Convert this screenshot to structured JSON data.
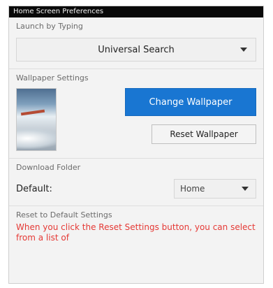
{
  "window": {
    "title": "Home Screen Preferences"
  },
  "launchpad": {
    "label": "Launch by Typing",
    "value": "Universal Search"
  },
  "wallpaper": {
    "label": "Wallpaper Settings",
    "change_button": "Change Wallpaper",
    "reset_button": "Reset Wallpaper"
  },
  "folder": {
    "label": "Download Folder",
    "field_label": "Default:",
    "value": "Home"
  },
  "reset": {
    "label": "Reset to Default Settings",
    "warning": "When you click the Reset Settings button, you can select from a list of"
  },
  "colors": {
    "accent": "#1976d2",
    "warning": "#e53935"
  }
}
